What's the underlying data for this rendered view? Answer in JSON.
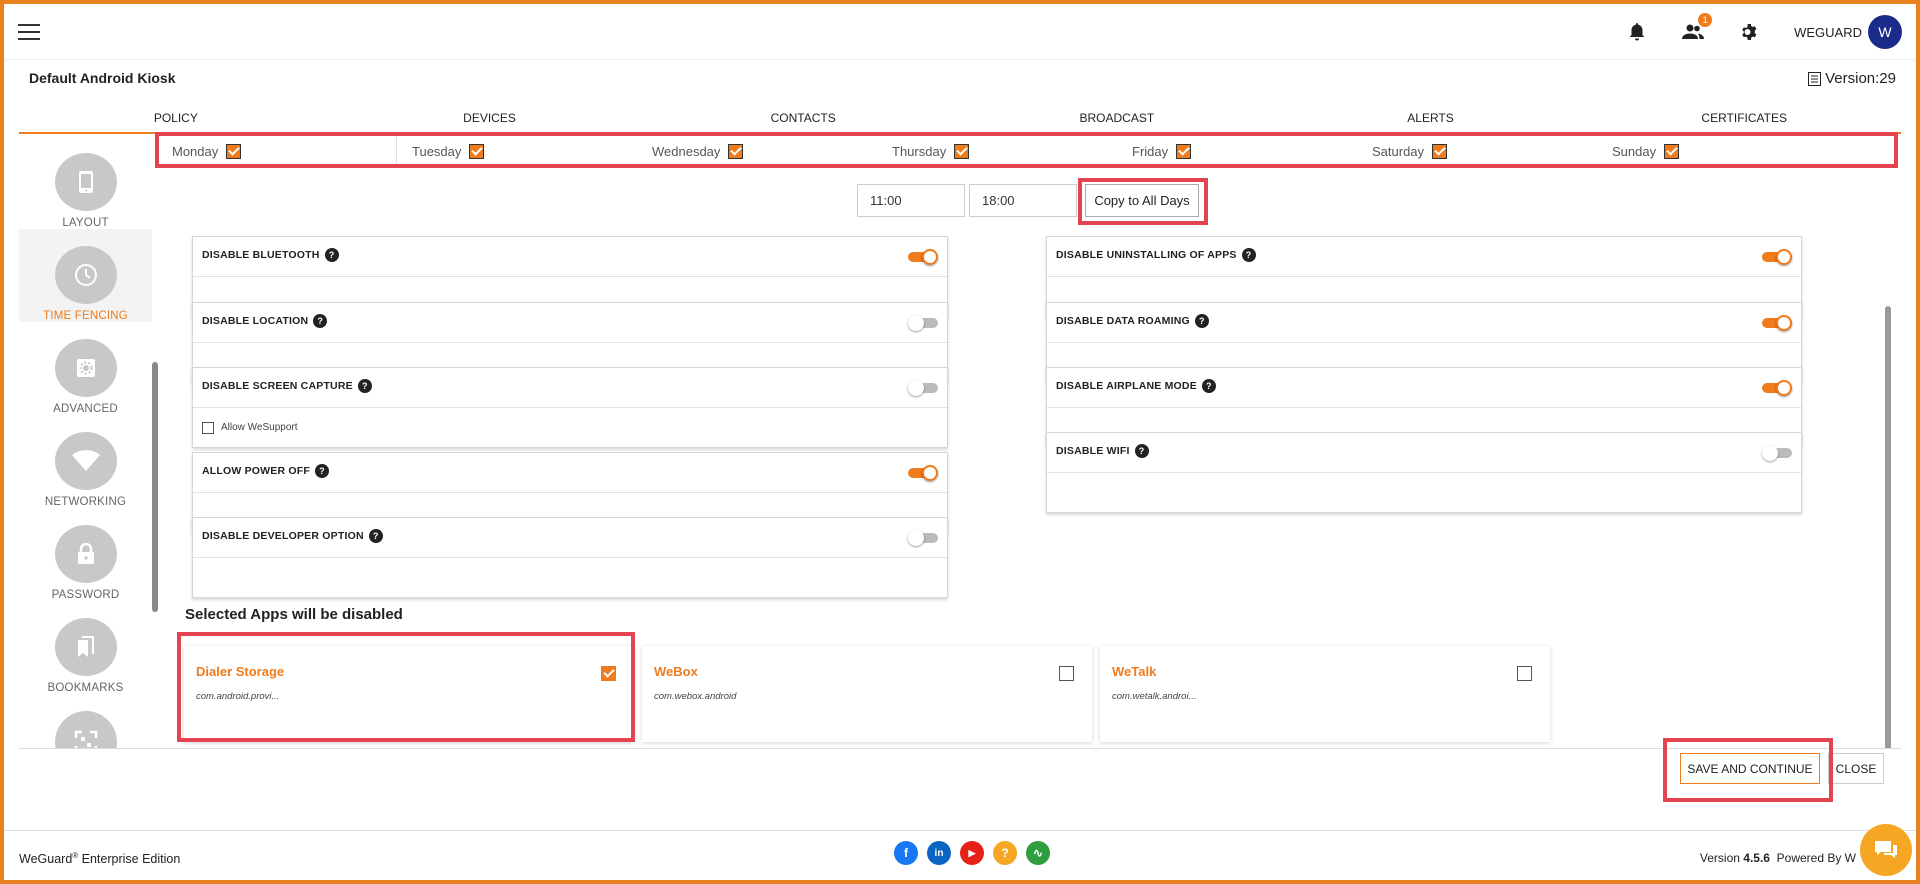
{
  "header": {
    "user_name": "WEGUARD",
    "avatar_initial": "W",
    "notification_count": "1",
    "page_title": "Default Android Kiosk",
    "version": "Version:29"
  },
  "tabs": [
    "POLICY",
    "DEVICES",
    "CONTACTS",
    "BROADCAST",
    "ALERTS",
    "CERTIFICATES"
  ],
  "sidebar": {
    "items": [
      {
        "label": "LAYOUT",
        "icon": "phone-icon"
      },
      {
        "label": "TIME FENCING",
        "icon": "clock-icon",
        "active": true
      },
      {
        "label": "ADVANCED",
        "icon": "gear-icon"
      },
      {
        "label": "NETWORKING",
        "icon": "wifi-icon"
      },
      {
        "label": "PASSWORD",
        "icon": "lock-icon"
      },
      {
        "label": "BOOKMARKS",
        "icon": "bookmark-icon"
      },
      {
        "label": "",
        "icon": "qr-icon"
      }
    ]
  },
  "days": [
    "Monday",
    "Tuesday",
    "Wednesday",
    "Thursday",
    "Friday",
    "Saturday",
    "Sunday"
  ],
  "time": {
    "start": "11:00",
    "end": "18:00",
    "copy_label": "Copy to All Days"
  },
  "settings_left": [
    {
      "title": "DISABLE BLUETOOTH",
      "on": true
    },
    {
      "title": "DISABLE LOCATION",
      "on": false
    },
    {
      "title": "DISABLE SCREEN CAPTURE",
      "on": false,
      "sub": "Allow WeSupport"
    },
    {
      "title": "ALLOW POWER OFF",
      "on": true
    },
    {
      "title": "DISABLE DEVELOPER OPTION",
      "on": false
    }
  ],
  "settings_right": [
    {
      "title": "DISABLE UNINSTALLING OF APPS",
      "on": true
    },
    {
      "title": "DISABLE DATA ROAMING",
      "on": true
    },
    {
      "title": "DISABLE AIRPLANE MODE",
      "on": true
    },
    {
      "title": "DISABLE WIFI",
      "on": false
    }
  ],
  "apps": {
    "title": "Selected Apps will be disabled",
    "items": [
      {
        "name": "Dialer Storage",
        "pkg": "com.android.provi...",
        "checked": true
      },
      {
        "name": "WeBox",
        "pkg": "com.webox.android",
        "checked": false
      },
      {
        "name": "WeTalk",
        "pkg": "com.wetalk.androi...",
        "checked": false
      }
    ]
  },
  "actions": {
    "save": "SAVE AND CONTINUE",
    "close": "CLOSE"
  },
  "footer": {
    "brand": "WeGuard",
    "reg": "®",
    "edition": " Enterprise Edition",
    "version_prefix": "Version ",
    "version_number": "4.5.6",
    "powered": "Powered By W",
    "socials": [
      {
        "name": "facebook-icon",
        "glyph": "f",
        "color": "#1877f2"
      },
      {
        "name": "linkedin-icon",
        "glyph": "in",
        "color": "#0a66c2"
      },
      {
        "name": "youtube-icon",
        "glyph": "▶",
        "color": "#e62117"
      },
      {
        "name": "help-icon",
        "glyph": "?",
        "color": "#f5a623"
      },
      {
        "name": "health-icon",
        "glyph": "∿",
        "color": "#2e9e3e"
      }
    ]
  },
  "colors": {
    "accent": "#f07b1c",
    "highlight": "#e4444f",
    "avatar": "#1a2b8a"
  }
}
